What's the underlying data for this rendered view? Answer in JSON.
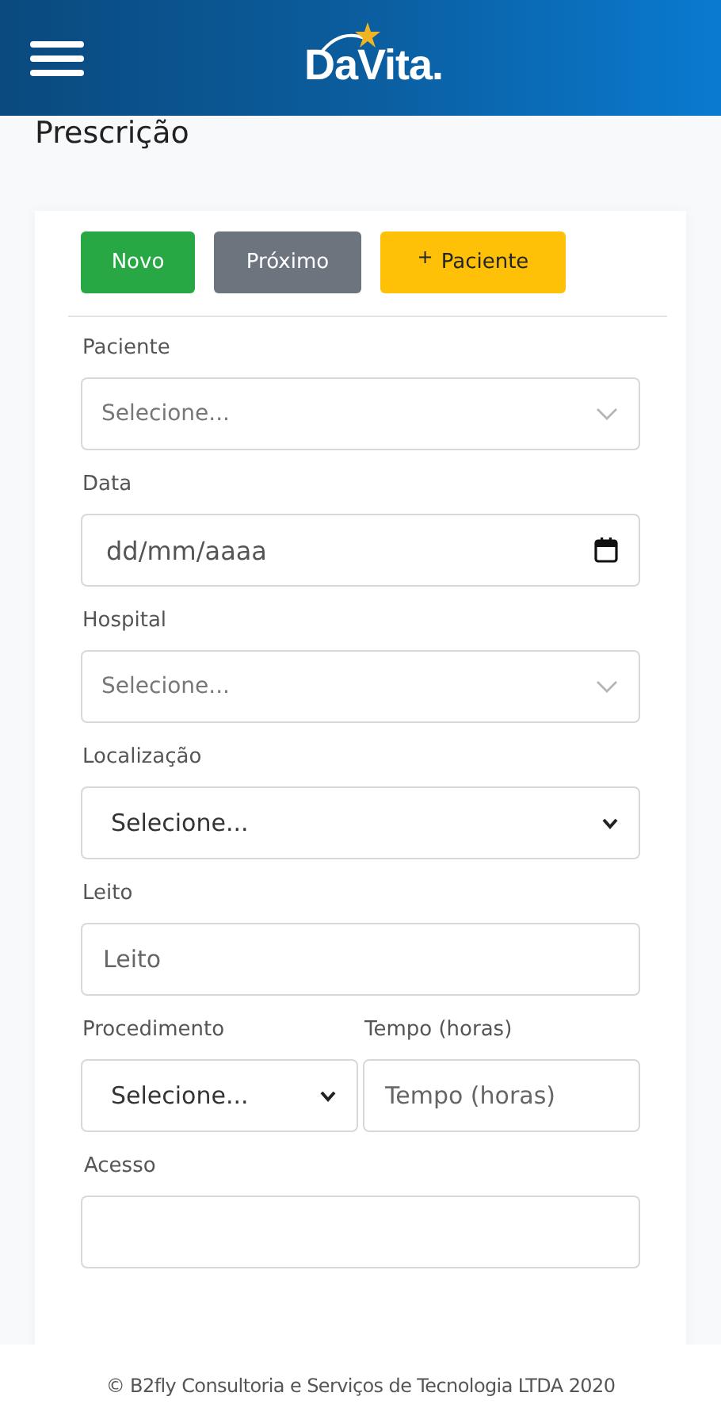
{
  "header": {
    "logo": "DaVita."
  },
  "page_title": "Prescrição",
  "buttons": [
    {
      "label": "Novo",
      "kind": "success"
    },
    {
      "label": "Próximo",
      "kind": "secondary"
    },
    {
      "label": "Paciente",
      "kind": "warning",
      "icon_text": "+"
    }
  ],
  "rows": [
    [
      {
        "label": "Paciente",
        "kind": "select-custom",
        "placeholder": "Selecione..."
      }
    ],
    [
      {
        "label": "Data",
        "kind": "date",
        "placeholder": "dd/mm/aaaa"
      }
    ],
    [
      {
        "label": "Hospital",
        "kind": "select-custom",
        "placeholder": "Selecione..."
      }
    ],
    [
      {
        "label": "Localização",
        "kind": "select-native",
        "value": "Selecione..."
      }
    ],
    [
      {
        "label": "Leito",
        "kind": "text",
        "placeholder": "Leito"
      }
    ],
    [
      {
        "label": "Procedimento",
        "kind": "select-native",
        "value": "Selecione..."
      },
      {
        "label": "Tempo (horas)",
        "kind": "text",
        "placeholder": "Tempo (horas)"
      }
    ],
    [
      {
        "label": "Acesso",
        "kind": "cut"
      }
    ]
  ],
  "footer": "© B2fly Consultoria e Serviços de Tecnologia LTDA 2020"
}
